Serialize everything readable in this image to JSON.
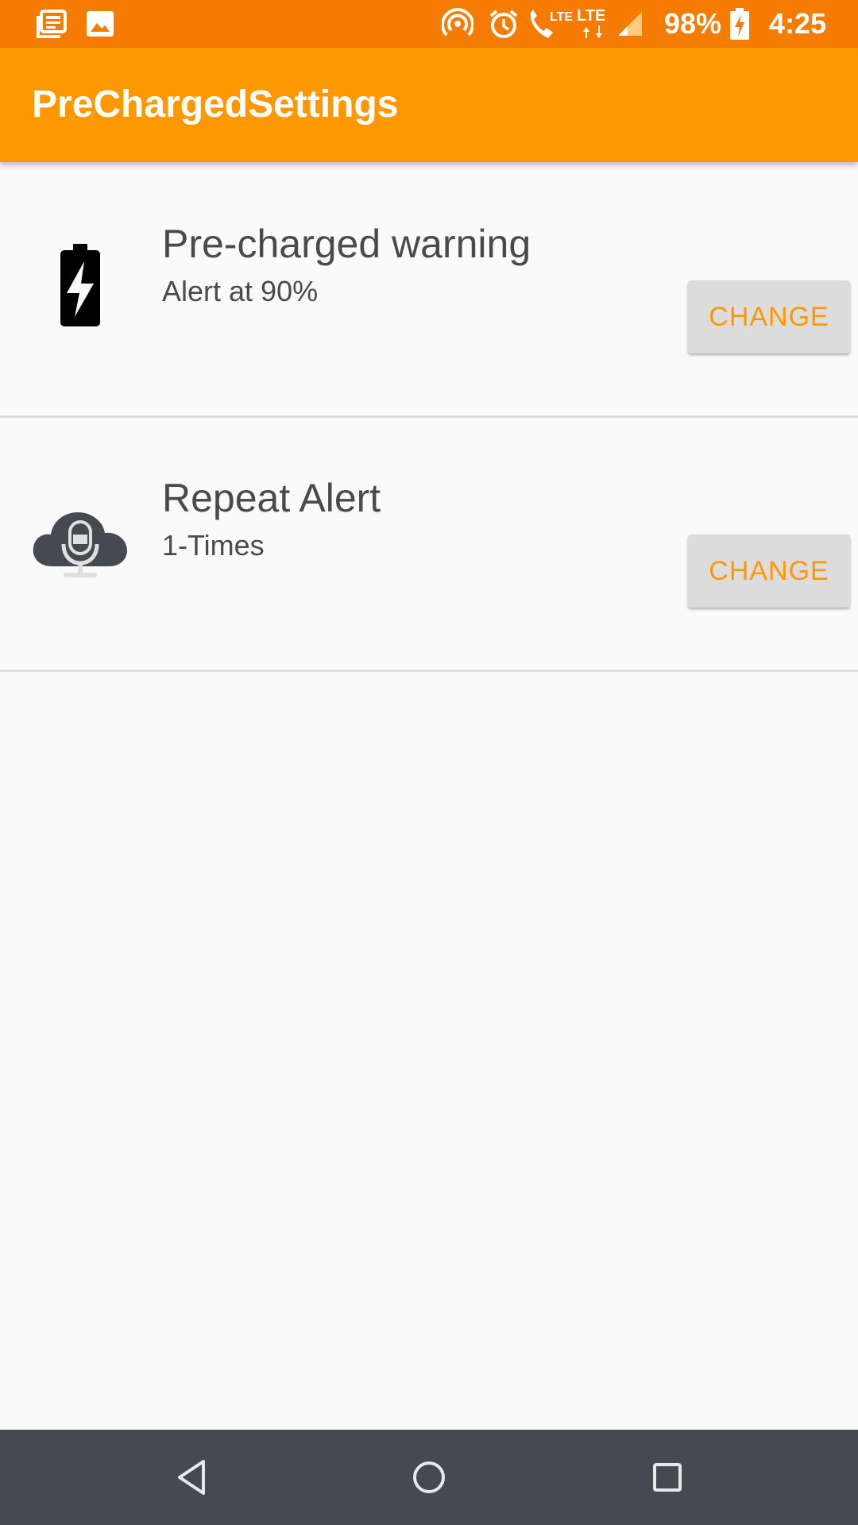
{
  "status_bar": {
    "battery_percent": "98%",
    "time": "4:25",
    "lte_call_label": "LTE",
    "lte_data_label": "LTE",
    "icons": [
      "news-icon",
      "image-icon",
      "hotspot-icon",
      "alarm-icon",
      "wifi-call-icon",
      "lte-data-icon",
      "signal-icon",
      "battery-charging-icon"
    ]
  },
  "app_bar": {
    "title": "PreChargedSettings"
  },
  "settings": [
    {
      "title": "Pre-charged warning",
      "subtitle": "Alert at 90%",
      "button_label": "CHANGE",
      "icon": "battery-charging-icon"
    },
    {
      "title": "Repeat Alert",
      "subtitle": "1-Times",
      "button_label": "CHANGE",
      "icon": "cloud-microphone-icon"
    }
  ],
  "nav_bar": {
    "icons": [
      "back-icon",
      "home-icon",
      "recents-icon"
    ]
  },
  "colors": {
    "status_bar": "#f57c00",
    "app_bar": "#ff9800",
    "accent": "#ff9800",
    "nav_bar": "#454a52"
  }
}
